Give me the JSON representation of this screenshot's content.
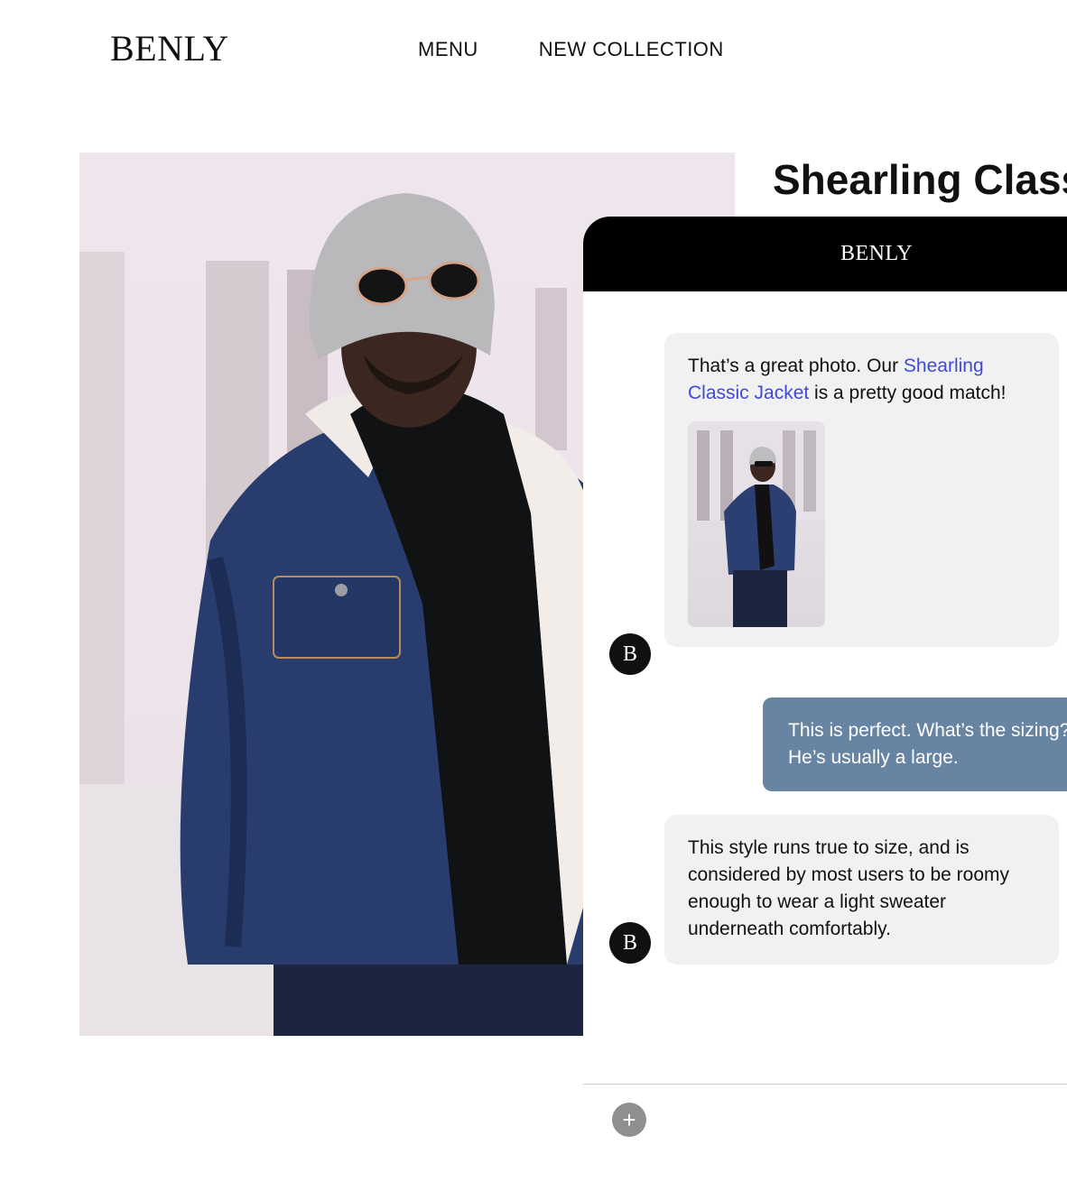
{
  "brand": {
    "logo": "BENLY"
  },
  "nav": {
    "items": [
      "MENU",
      "NEW COLLECTION"
    ]
  },
  "product": {
    "title": "Shearling Class"
  },
  "chat": {
    "header_logo": "BENLY",
    "avatar_letter": "B",
    "messages": [
      {
        "from": "bot",
        "text_before": "That’s a great photo. Our ",
        "link": "Shearling Classic Jacket",
        "text_after": " is a pretty good match!"
      },
      {
        "from": "user",
        "text": "This is perfect. What’s the sizing? He’s usually a large."
      },
      {
        "from": "bot",
        "text": "This style runs true to size, and is considered by most users to be roomy enough to wear a light sweater underneath comfortably."
      }
    ],
    "add_button": "+"
  },
  "colors": {
    "chat_header": "#000000",
    "user_bubble": "#6785a3",
    "bot_bubble": "#f1f1f1",
    "link": "#3f4ad6"
  }
}
